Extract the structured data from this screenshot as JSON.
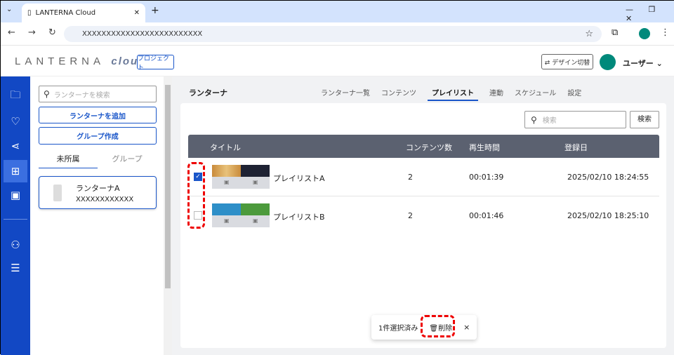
{
  "browser": {
    "tab_title": "LANTERNA Cloud",
    "url": "XXXXXXXXXXXXXXXXXXXXXXXXX"
  },
  "header": {
    "logo": "LANTERNA",
    "logo_suffix": "cloud",
    "project_button": "プロジェクト",
    "design_button": "⇄ デザイン切替",
    "user": "ユーザー",
    "avatar_color": "#00897b"
  },
  "left": {
    "search_placeholder": "ランターナを検索",
    "add_button": "ランターナを追加",
    "group_button": "グループ作成",
    "tabs": [
      "未所属",
      "グループ"
    ],
    "device": {
      "name": "ランターナA",
      "id": "XXXXXXXXXXXX"
    }
  },
  "main": {
    "title": "ランターナ",
    "tabs": [
      "ランターナ一覧",
      "コンテンツ",
      "プレイリスト",
      "連動",
      "スケジュール",
      "設定"
    ],
    "active_tab": 2,
    "search_placeholder": "検索",
    "search_button": "検索",
    "columns": [
      "タイトル",
      "コンテンツ数",
      "再生時間",
      "登録日"
    ],
    "rows": [
      {
        "title": "プレイリストA",
        "count": "2",
        "duration": "00:01:39",
        "date": "2025/02/10 18:24:55",
        "checked": true
      },
      {
        "title": "プレイリストB",
        "count": "2",
        "duration": "00:01:46",
        "date": "2025/02/10 18:25:10",
        "checked": false
      }
    ]
  },
  "toast": {
    "selected": "1件選択済み",
    "delete": "削除",
    "close": "×"
  }
}
